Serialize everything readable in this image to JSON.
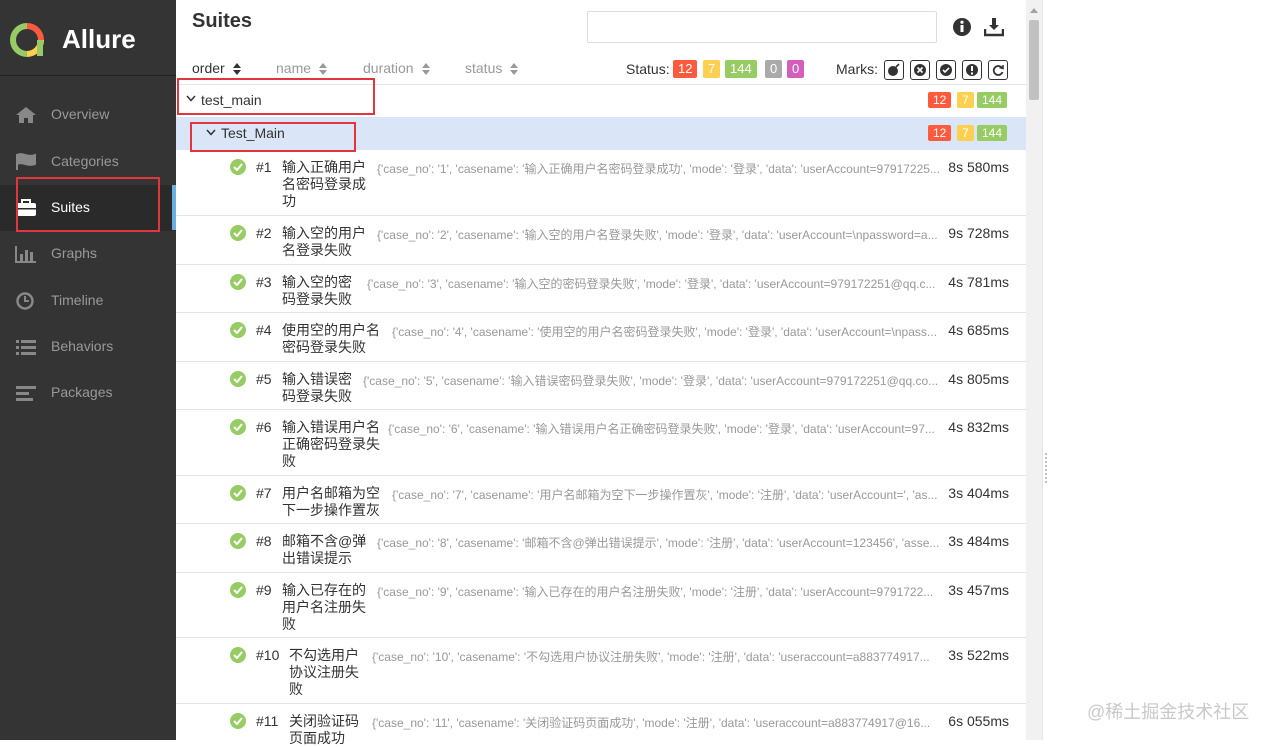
{
  "app": {
    "brand": "Allure"
  },
  "sidebar": {
    "items": [
      {
        "label": "Overview",
        "icon": "home-icon"
      },
      {
        "label": "Categories",
        "icon": "flag-icon"
      },
      {
        "label": "Suites",
        "icon": "briefcase-icon",
        "active": true
      },
      {
        "label": "Graphs",
        "icon": "bar-chart-icon"
      },
      {
        "label": "Timeline",
        "icon": "clock-icon"
      },
      {
        "label": "Behaviors",
        "icon": "list-icon"
      },
      {
        "label": "Packages",
        "icon": "align-left-icon"
      }
    ]
  },
  "header": {
    "title": "Suites",
    "search_placeholder": "",
    "info_icon": "info-icon",
    "download_icon": "download-icon"
  },
  "toolbar": {
    "sorters": [
      "order",
      "name",
      "duration",
      "status"
    ],
    "status_label": "Status:",
    "status_counts": {
      "failed": "12",
      "broken": "7",
      "passed": "144",
      "skipped": "0",
      "unknown": "0"
    },
    "marks_label": "Marks:",
    "marks": [
      "bomb-icon",
      "x-circle-icon",
      "check-circle-icon",
      "exclamation-icon",
      "refresh-icon"
    ]
  },
  "tree": {
    "root": {
      "name": "test_main",
      "failed": "12",
      "broken": "7",
      "passed": "144"
    },
    "suite": {
      "name": "Test_Main",
      "failed": "12",
      "broken": "7",
      "passed": "144"
    },
    "cases": [
      {
        "num": "#1",
        "title": "输入正确用户名密码登录成功",
        "params": "{'case_no': '1', 'casename': '输入正确用户名密码登录成功', 'mode': '登录', 'data': 'userAccount=97917225...",
        "duration": "8s 580ms"
      },
      {
        "num": "#2",
        "title": "输入空的用户名登录失败",
        "params": "{'case_no': '2', 'casename': '输入空的用户名登录失败', 'mode': '登录', 'data': 'userAccount=\\npassword=a...",
        "duration": "9s 728ms"
      },
      {
        "num": "#3",
        "title": "输入空的密码登录失败",
        "params": "{'case_no': '3', 'casename': '输入空的密码登录失败', 'mode': '登录', 'data': 'userAccount=979172251@qq.c...",
        "duration": "4s 781ms"
      },
      {
        "num": "#4",
        "title": "使用空的用户名密码登录失败",
        "params": "{'case_no': '4', 'casename': '使用空的用户名密码登录失败', 'mode': '登录', 'data': 'userAccount=\\npass...",
        "duration": "4s 685ms"
      },
      {
        "num": "#5",
        "title": "输入错误密码登录失败",
        "params": "{'case_no': '5', 'casename': '输入错误密码登录失败', 'mode': '登录', 'data': 'userAccount=979172251@qq.co...",
        "duration": "4s 805ms"
      },
      {
        "num": "#6",
        "title": "输入错误用户名正确密码登录失败",
        "params": "{'case_no': '6', 'casename': '输入错误用户名正确密码登录失败', 'mode': '登录', 'data': 'userAccount=97...",
        "duration": "4s 832ms"
      },
      {
        "num": "#7",
        "title": "用户名邮箱为空下一步操作置灰",
        "params": "{'case_no': '7', 'casename': '用户名邮箱为空下一步操作置灰', 'mode': '注册', 'data': 'userAccount=', 'as...",
        "duration": "3s 404ms"
      },
      {
        "num": "#8",
        "title": "邮箱不含@弹出错误提示",
        "params": "{'case_no': '8', 'casename': '邮箱不含@弹出错误提示', 'mode': '注册', 'data': 'userAccount=123456', 'asse...",
        "duration": "3s 484ms"
      },
      {
        "num": "#9",
        "title": "输入已存在的用户名注册失败",
        "params": "{'case_no': '9', 'casename': '输入已存在的用户名注册失败', 'mode': '注册', 'data': 'userAccount=9791722...",
        "duration": "3s 457ms"
      },
      {
        "num": "#10",
        "title": "不勾选用户协议注册失败",
        "params": "{'case_no': '10', 'casename': '不勾选用户协议注册失败', 'mode': '注册', 'data': 'useraccount=a883774917...",
        "duration": "3s 522ms"
      },
      {
        "num": "#11",
        "title": "关闭验证码页面成功",
        "params": "{'case_no': '11', 'casename': '关闭验证码页面成功', 'mode': '注册', 'data': 'useraccount=a883774917@16...",
        "duration": "6s 055ms"
      }
    ]
  },
  "watermark": "@稀土掘金技术社区",
  "colors": {
    "failed": "#fd5a3e",
    "broken": "#ffd050",
    "passed": "#97cc64",
    "skipped": "#aaaaaa",
    "unknown": "#d35ebe",
    "sidebar_bg": "#343434",
    "annotation": "#e0363c"
  }
}
